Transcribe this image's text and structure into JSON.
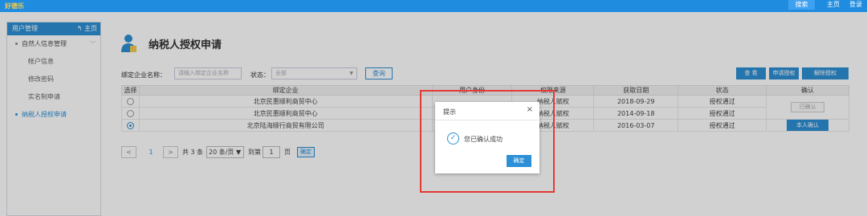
{
  "topbar": {
    "logo": "好德乐",
    "search": "搜索",
    "home": "主页",
    "logout": "登录"
  },
  "sidebar": {
    "header": "用户管理",
    "home_link": "主页",
    "group_label": "自然人信息管理",
    "items": [
      {
        "label": "帐户信息"
      },
      {
        "label": "修改密码"
      },
      {
        "label": "实名制申请"
      }
    ],
    "active_item": "纳税人授权申请"
  },
  "page": {
    "title": "纳税人授权申请"
  },
  "filters": {
    "company_label": "绑定企业名称：",
    "company_placeholder": "请输入绑定企业名称",
    "status_label": "状态：",
    "status_value": "全部",
    "query_button": "查询"
  },
  "actions": {
    "view": "查 看",
    "apply": "申请授权",
    "revoke": "解除授权"
  },
  "table": {
    "headers": [
      "选择",
      "绑定企业",
      "用户身份",
      "权限来源",
      "获取日期",
      "状态",
      "确认"
    ],
    "rows": [
      {
        "company": "北京民惠顺利商贸中心",
        "identity": "",
        "source": "纳税人赋权",
        "date": "2018-09-29",
        "status": "授权通过",
        "confirm": "已确认",
        "selected": false
      },
      {
        "company": "北京民惠顺利商贸中心",
        "identity": "",
        "source": "纳税人赋权",
        "date": "2014-09-18",
        "status": "授权通过",
        "confirm": "",
        "selected": false
      },
      {
        "company": "北京陆海顺行商贸有限公司",
        "identity": "",
        "source": "纳税人赋权",
        "date": "2016-03-07",
        "status": "授权通过",
        "confirm": "本人确认",
        "selected": true
      }
    ]
  },
  "pagination": {
    "prev": "<",
    "current": "1",
    "next": ">",
    "total": "共 3 条",
    "page_size": "20 条/页 ▼",
    "goto": "到第",
    "page_input": "1",
    "page_unit": "页",
    "confirm": "确定"
  },
  "dialog": {
    "title": "提示",
    "close": "×",
    "message": "您已确认成功",
    "ok": "确定"
  },
  "colors": {
    "primary": "#2d8fd5",
    "topbar": "#1f8ce0",
    "highlight": "#e53935"
  }
}
